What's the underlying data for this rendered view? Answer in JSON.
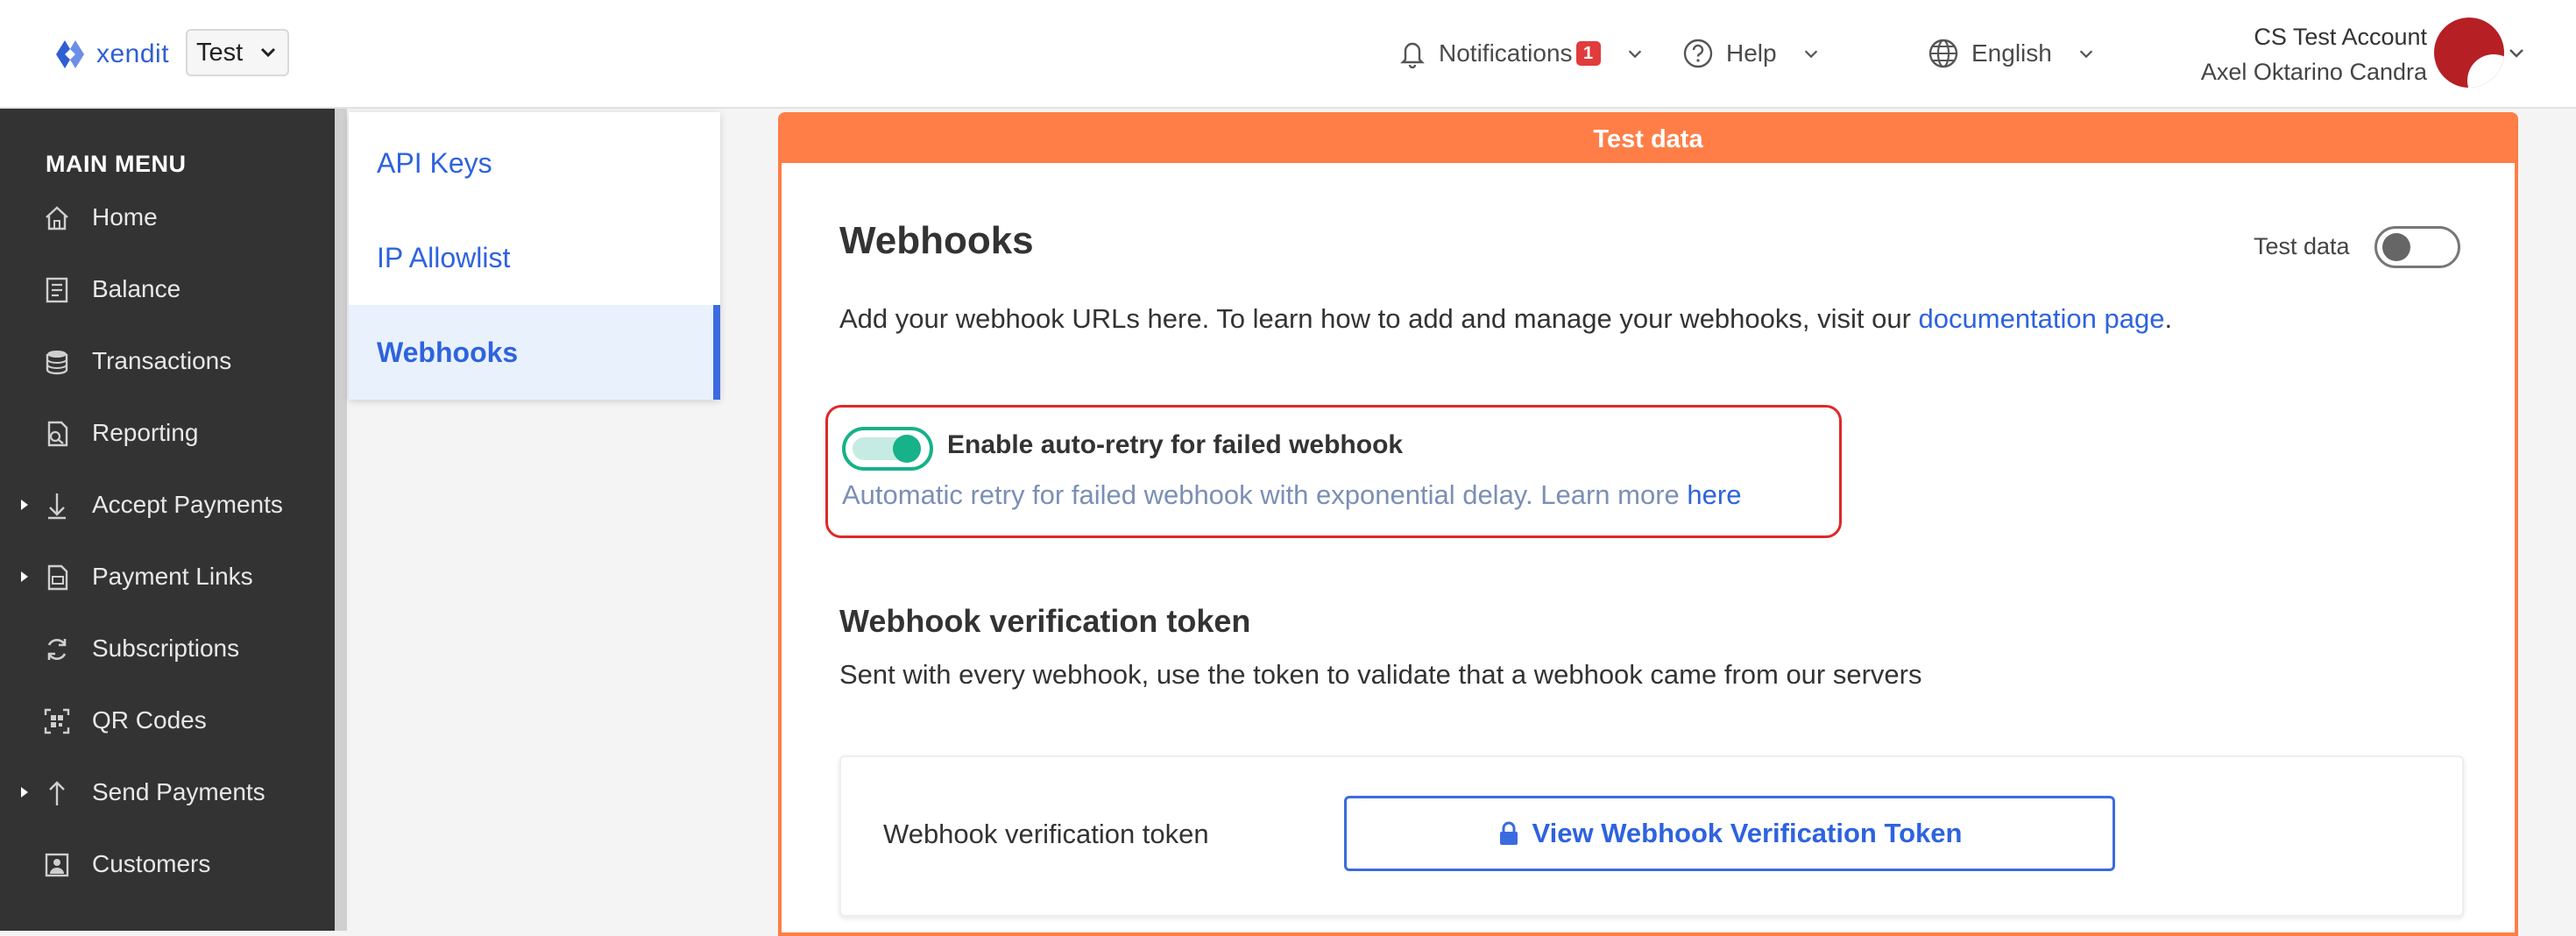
{
  "header": {
    "logo_text": "xendit",
    "env_select": {
      "value": "Test"
    },
    "notifications": {
      "label": "Notifications",
      "count": "1"
    },
    "help": {
      "label": "Help"
    },
    "language": {
      "label": "English"
    },
    "account": {
      "name": "CS Test Account",
      "user": "Axel Oktarino Candra"
    }
  },
  "sidebar": {
    "title": "MAIN MENU",
    "items": [
      {
        "label": "Home",
        "icon": "home-icon",
        "expandable": false
      },
      {
        "label": "Balance",
        "icon": "balance-icon",
        "expandable": false
      },
      {
        "label": "Transactions",
        "icon": "transactions-icon",
        "expandable": false
      },
      {
        "label": "Reporting",
        "icon": "reporting-icon",
        "expandable": false
      },
      {
        "label": "Accept Payments",
        "icon": "accept-payments-icon",
        "expandable": true
      },
      {
        "label": "Payment Links",
        "icon": "payment-links-icon",
        "expandable": true
      },
      {
        "label": "Subscriptions",
        "icon": "subscriptions-icon",
        "expandable": false
      },
      {
        "label": "QR Codes",
        "icon": "qr-code-icon",
        "expandable": false
      },
      {
        "label": "Send Payments",
        "icon": "send-payments-icon",
        "expandable": true
      },
      {
        "label": "Customers",
        "icon": "customers-icon",
        "expandable": false
      }
    ]
  },
  "subnav": {
    "items": [
      {
        "label": "API Keys",
        "active": false
      },
      {
        "label": "IP Allowlist",
        "active": false
      },
      {
        "label": "Webhooks",
        "active": true
      }
    ]
  },
  "main": {
    "banner": "Test data",
    "title": "Webhooks",
    "test_toggle_label": "Test data",
    "description_prefix": "Add your webhook URLs here. To learn how to add and manage your webhooks, visit our ",
    "description_link": "documentation page",
    "description_suffix": ".",
    "auto_retry": {
      "title": "Enable auto-retry for failed webhook",
      "description": "Automatic retry for failed webhook with exponential delay. Learn more ",
      "link": "here",
      "enabled": true
    },
    "token_section": {
      "title": "Webhook verification token",
      "description": "Sent with every webhook, use the token to validate that a webhook came from our servers",
      "row_label": "Webhook verification token",
      "button_label": "View Webhook Verification Token"
    }
  },
  "colors": {
    "accent": "#ff7e47",
    "link": "#2e63de",
    "toggle_on": "#17b18a",
    "highlight_border": "#e02828",
    "sidebar_bg": "#333333"
  }
}
